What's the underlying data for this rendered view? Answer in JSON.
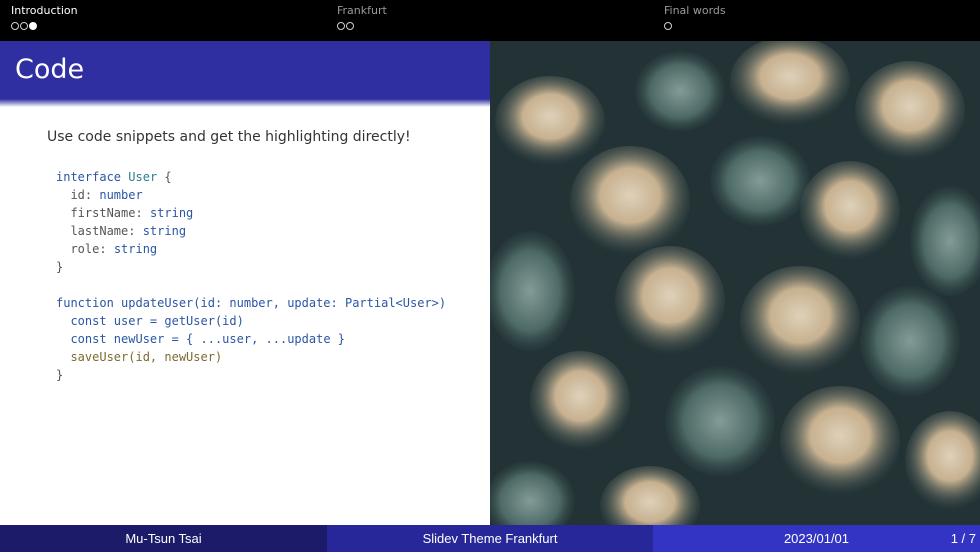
{
  "nav": {
    "sections": [
      {
        "title": "Introduction",
        "dots": [
          "empty",
          "empty",
          "filled"
        ]
      },
      {
        "title": "Frankfurt",
        "dots": [
          "empty",
          "empty"
        ]
      },
      {
        "title": "Final words",
        "dots": [
          "empty"
        ]
      }
    ]
  },
  "slide": {
    "title": "Code",
    "intro": "Use code snippets and get the highlighting directly!",
    "code": {
      "interface_line": {
        "kw": "interface",
        "name": "User",
        "brace": " {"
      },
      "fields": [
        {
          "name": "id",
          "type": "number"
        },
        {
          "name": "firstName",
          "type": "string"
        },
        {
          "name": "lastName",
          "type": "string"
        },
        {
          "name": "role",
          "type": "string"
        }
      ],
      "close": "}",
      "fn_line": "function updateUser(id: number, update: Partial<User>)",
      "body": [
        "const user = getUser(id)",
        "const newUser = { ...user, ...update }",
        "saveUser(id, newUser)"
      ]
    }
  },
  "image": {
    "alt": "aerial view of pine forest"
  },
  "footer": {
    "author": "Mu-Tsun Tsai",
    "theme": "Slidev Theme Frankfurt",
    "date": "2023/01/01",
    "page": "1 / 7"
  },
  "colors": {
    "header": "#2f2fa2",
    "footer_left": "#1b1b6a",
    "footer_mid": "#27279a",
    "footer_right": "#3434c4"
  }
}
